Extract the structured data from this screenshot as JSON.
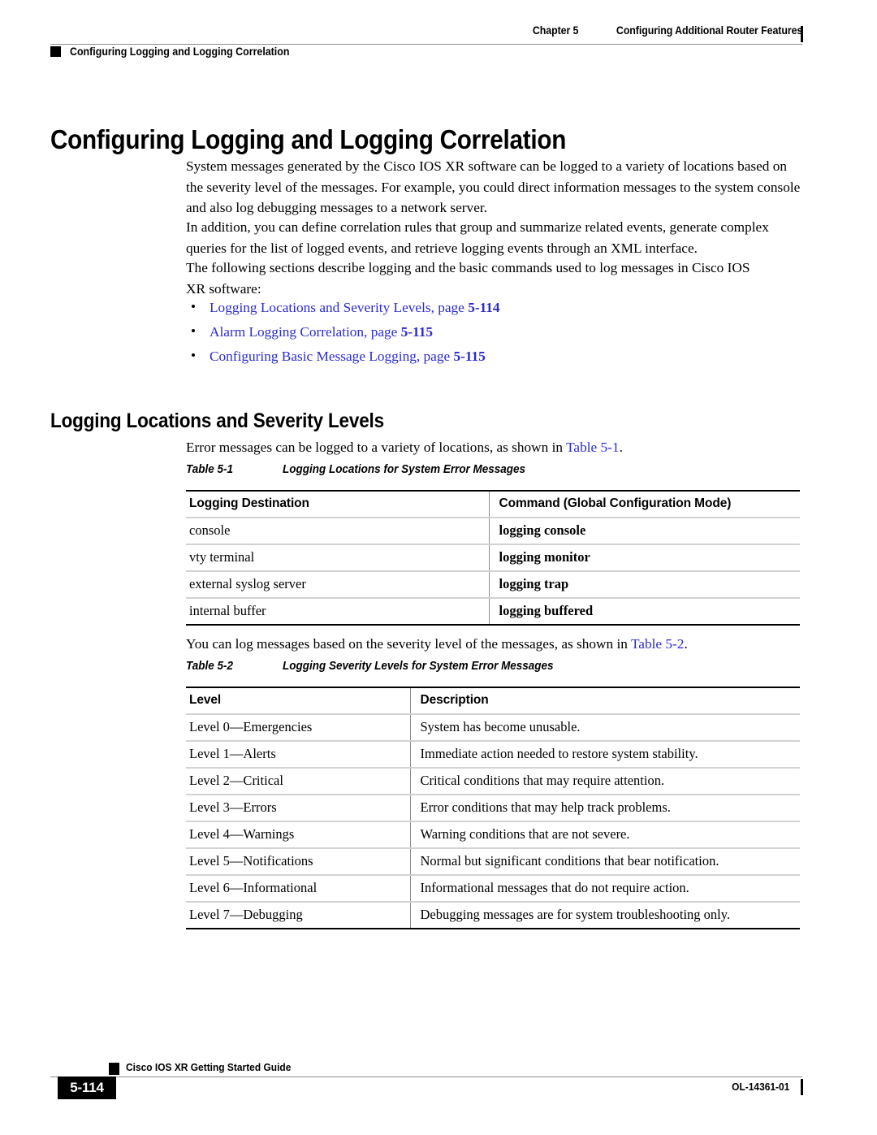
{
  "header": {
    "chapter_number": "Chapter 5",
    "chapter_title": "Configuring Additional Router Features",
    "running_head": "Configuring Logging and Logging Correlation"
  },
  "chapter_title": "Configuring Logging and Logging Correlation",
  "paragraphs": {
    "intro_1": "System messages generated by the Cisco IOS XR software can be logged to a variety of locations based on the severity level of the messages. For example, you could direct information messages to the system console and also log debugging messages to a network server.",
    "intro_2": "In addition, you can define correlation rules that group and summarize related events, generate complex queries for the list of logged events, and retrieve logging events through an XML interface.",
    "intro_3": "The following sections describe logging and the basic commands used to log messages in Cisco IOS XR software:",
    "before_table_1_pre": "Error messages can be logged to a variety of locations, as shown in ",
    "before_table_1_link": "Table 5-1",
    "before_table_1_post": ".",
    "before_table_2_pre": "You can log messages based on the severity level of the messages, as shown in ",
    "before_table_2_link": "Table 5-2",
    "before_table_2_post": "."
  },
  "bullets": [
    {
      "text": "Logging Locations and Severity Levels, page ",
      "page": "5-114"
    },
    {
      "text": "Alarm Logging Correlation, page ",
      "page": "5-115"
    },
    {
      "text": "Configuring Basic Message Logging, page ",
      "page": "5-115"
    }
  ],
  "section_title": "Logging Locations and Severity Levels",
  "table_1": {
    "caption_number": "Table 5-1",
    "caption_title": "Logging Locations for System Error Messages",
    "columns": [
      "Logging Destination",
      "Command (Global Configuration Mode)"
    ],
    "rows": [
      [
        "console",
        "logging console"
      ],
      [
        "vty terminal",
        "logging monitor"
      ],
      [
        "external syslog server",
        "logging trap"
      ],
      [
        "internal buffer",
        "logging buffered"
      ]
    ]
  },
  "table_2": {
    "caption_number": "Table 5-2",
    "caption_title": "Logging Severity Levels for System Error Messages",
    "columns": [
      "Level",
      "Description"
    ],
    "rows": [
      [
        "Level 0—Emergencies",
        "System has become unusable."
      ],
      [
        "Level 1—Alerts",
        "Immediate action needed to restore system stability."
      ],
      [
        "Level 2—Critical",
        "Critical conditions that may require attention."
      ],
      [
        "Level 3—Errors",
        "Error conditions that may help track problems."
      ],
      [
        "Level 4—Warnings",
        "Warning conditions that are not severe."
      ],
      [
        "Level 5—Notifications",
        "Normal but significant conditions that bear notification."
      ],
      [
        "Level 6—Informational",
        "Informational messages that do not require action."
      ],
      [
        "Level 7—Debugging",
        "Debugging messages are for system troubleshooting only."
      ]
    ]
  },
  "footer": {
    "guide_title": "Cisco IOS XR Getting Started Guide",
    "page_number": "5-114",
    "doc_id": "OL-14361-01"
  },
  "colors": {
    "link": "#2b2bd4",
    "rule": "#8d8d8d",
    "row_divider": "#d2d2d2",
    "text": "#000000"
  }
}
